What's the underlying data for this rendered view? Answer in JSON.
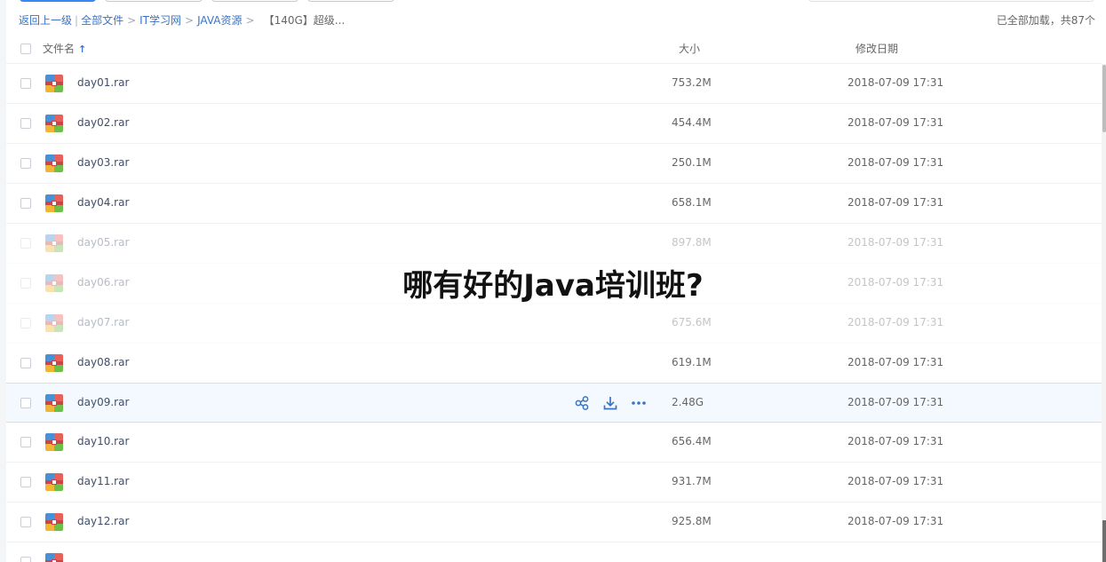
{
  "breadcrumb": {
    "back": "返回上一级",
    "all_files": "全部文件",
    "items": [
      "IT学习网",
      "JAVA资源"
    ],
    "current": "【140G】超级...",
    "separator": ">"
  },
  "load_status": "已全部加载，共87个",
  "header": {
    "name": "文件名",
    "sort_arrow": "↑",
    "size": "大小",
    "date": "修改日期"
  },
  "files": [
    {
      "name": "day01.rar",
      "size": "753.2M",
      "date": "2018-07-09 17:31"
    },
    {
      "name": "day02.rar",
      "size": "454.4M",
      "date": "2018-07-09 17:31"
    },
    {
      "name": "day03.rar",
      "size": "250.1M",
      "date": "2018-07-09 17:31"
    },
    {
      "name": "day04.rar",
      "size": "658.1M",
      "date": "2018-07-09 17:31"
    },
    {
      "name": "day05.rar",
      "size": "897.8M",
      "date": "2018-07-09 17:31"
    },
    {
      "name": "day06.rar",
      "size": "",
      "date": "2018-07-09 17:31"
    },
    {
      "name": "day07.rar",
      "size": "675.6M",
      "date": "2018-07-09 17:31"
    },
    {
      "name": "day08.rar",
      "size": "619.1M",
      "date": "2018-07-09 17:31"
    },
    {
      "name": "day09.rar",
      "size": "2.48G",
      "date": "2018-07-09 17:31"
    },
    {
      "name": "day10.rar",
      "size": "656.4M",
      "date": "2018-07-09 17:31"
    },
    {
      "name": "day11.rar",
      "size": "931.7M",
      "date": "2018-07-09 17:31"
    },
    {
      "name": "day12.rar",
      "size": "925.8M",
      "date": "2018-07-09 17:31"
    }
  ],
  "row_actions": {
    "icons": [
      "share-icon",
      "download-icon",
      "more-icon"
    ]
  },
  "overlay_caption": "哪有好的Java培训班?",
  "colors": {
    "accent": "#3b8cff",
    "link": "#3b73c4",
    "hover_row": "#f4f8ff"
  }
}
